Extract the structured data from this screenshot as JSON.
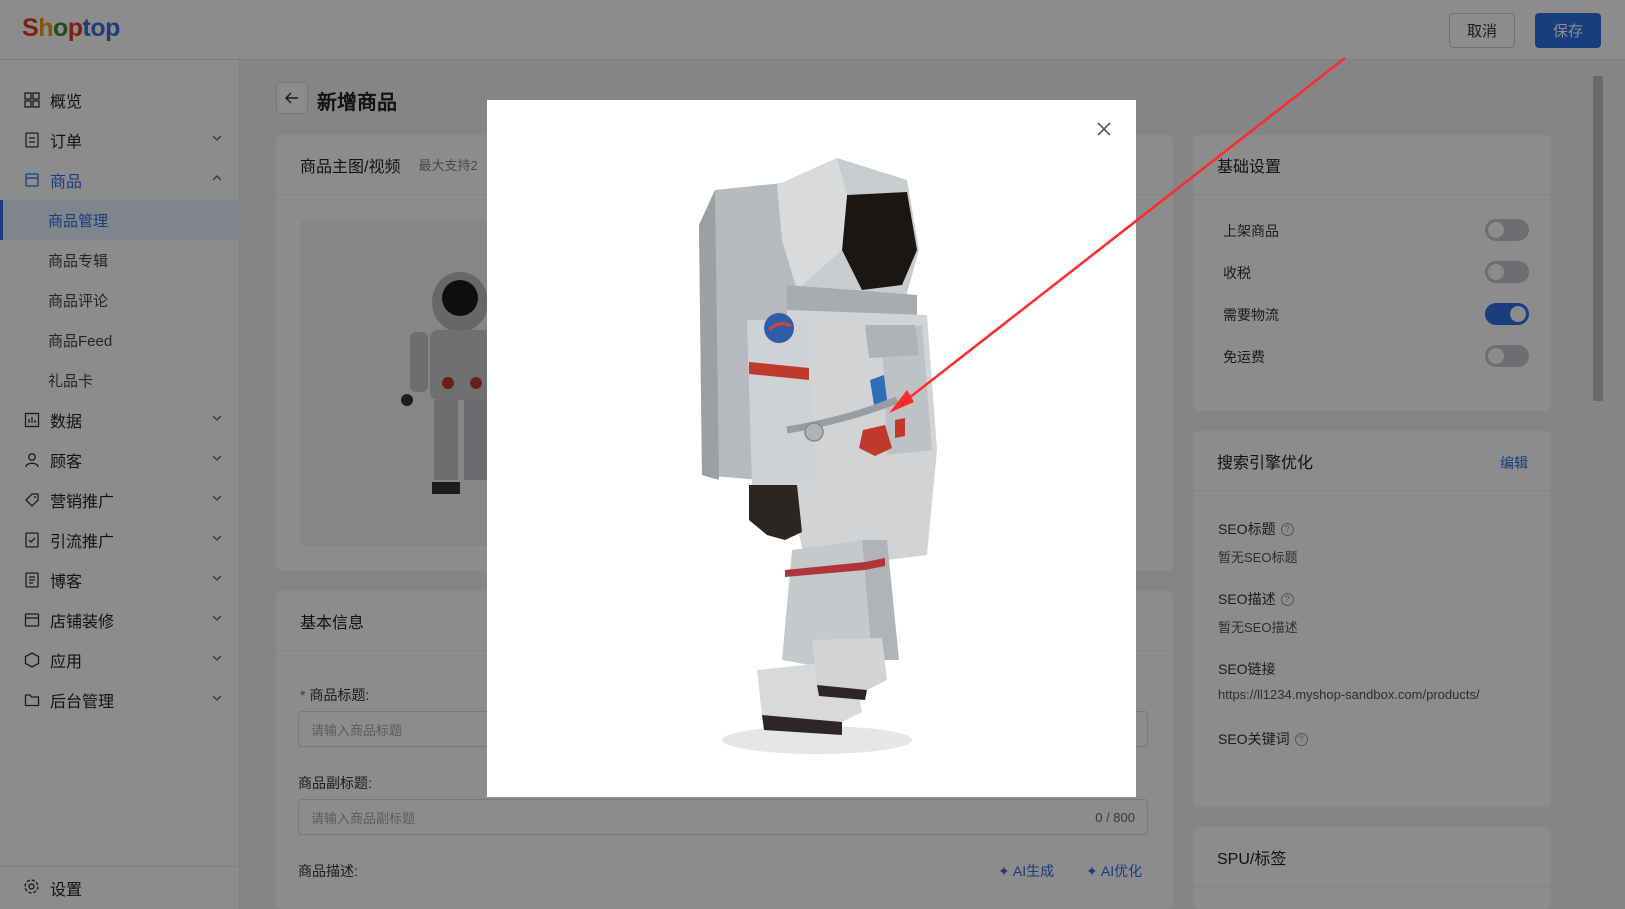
{
  "app": {
    "logo": "Shoptop"
  },
  "header": {
    "cancel_label": "取消",
    "save_label": "保存"
  },
  "sidebar": {
    "items": [
      {
        "label": "概览",
        "icon": "dashboard-icon"
      },
      {
        "label": "订单",
        "icon": "order-icon"
      },
      {
        "label": "商品",
        "icon": "product-icon"
      },
      {
        "label": "数据",
        "icon": "chart-icon"
      },
      {
        "label": "顾客",
        "icon": "user-icon"
      },
      {
        "label": "营销推广",
        "icon": "tag-icon"
      },
      {
        "label": "引流推广",
        "icon": "traffic-icon"
      },
      {
        "label": "博客",
        "icon": "blog-icon"
      },
      {
        "label": "店铺装修",
        "icon": "store-icon"
      },
      {
        "label": "应用",
        "icon": "app-icon"
      },
      {
        "label": "后台管理",
        "icon": "folder-icon"
      }
    ],
    "sub_items": [
      "商品管理",
      "商品专辑",
      "商品评论",
      "商品Feed",
      "礼品卡"
    ],
    "settings_label": "设置"
  },
  "page": {
    "title": "新增商品"
  },
  "media_card": {
    "title": "商品主图/视频",
    "hint": "最大支持2"
  },
  "basic_card": {
    "title": "基本信息",
    "title_label": "商品标题:",
    "title_placeholder": "请输入商品标题",
    "subtitle_label": "商品副标题:",
    "subtitle_placeholder": "请输入商品副标题",
    "subtitle_counter": "0 / 800",
    "desc_label": "商品描述:",
    "ai_generate": "AI生成",
    "ai_optimize": "AI优化"
  },
  "settings_card": {
    "title": "基础设置",
    "toggles": [
      {
        "label": "上架商品",
        "on": false
      },
      {
        "label": "收税",
        "on": false
      },
      {
        "label": "需要物流",
        "on": true
      },
      {
        "label": "免运费",
        "on": false
      }
    ]
  },
  "seo_card": {
    "title": "搜索引擎优化",
    "edit_label": "编辑",
    "seo_title_label": "SEO标题",
    "seo_title_value": "暂无SEO标题",
    "seo_desc_label": "SEO描述",
    "seo_desc_value": "暂无SEO描述",
    "seo_link_label": "SEO链接",
    "seo_link_value": "https://ll1234.myshop-sandbox.com/products/",
    "seo_keywords_label": "SEO关键词"
  },
  "spu_card": {
    "title": "SPU/标签"
  },
  "colors": {
    "accent": "#2f6fe4",
    "arrow": "#ff2a2a"
  }
}
